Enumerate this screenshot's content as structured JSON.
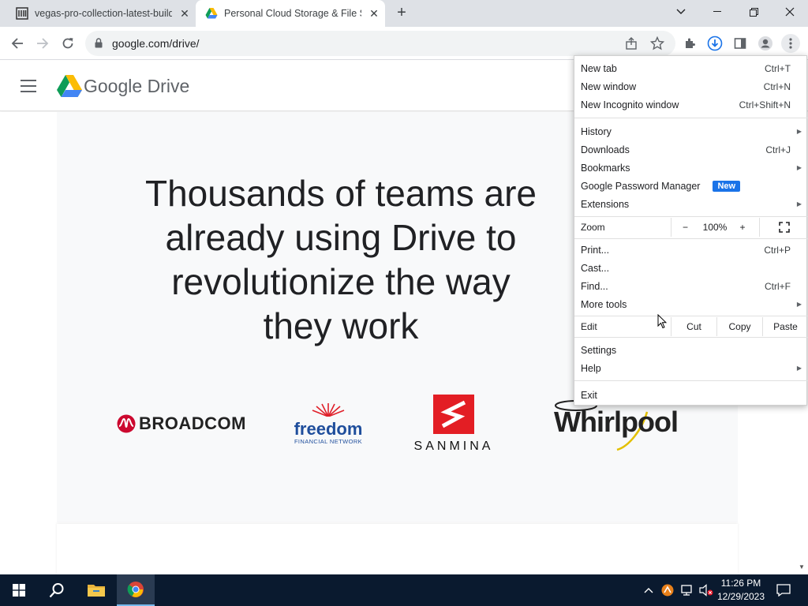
{
  "browser": {
    "tabs": [
      {
        "title": "vegas-pro-collection-latest-build",
        "active": false
      },
      {
        "title": "Personal Cloud Storage & File Sh",
        "active": true
      }
    ],
    "url": "google.com/drive/"
  },
  "page": {
    "brand": {
      "google": "Google",
      "drive": "Drive"
    },
    "hero": "Thousands of teams are already using Drive to revolutionize the way they work",
    "logos": {
      "broadcom": "BROADCOM",
      "freedom": "freedom",
      "freedom_sub": "FINANCIAL NETWORK",
      "sanmina": "SANMINA",
      "whirlpool": "Whirlpool"
    }
  },
  "menu": {
    "group1": [
      {
        "label": "New tab",
        "shortcut": "Ctrl+T"
      },
      {
        "label": "New window",
        "shortcut": "Ctrl+N"
      },
      {
        "label": "New Incognito window",
        "shortcut": "Ctrl+Shift+N"
      }
    ],
    "group2": [
      {
        "label": "History",
        "submenu": true
      },
      {
        "label": "Downloads",
        "shortcut": "Ctrl+J"
      },
      {
        "label": "Bookmarks",
        "submenu": true
      },
      {
        "label": "Google Password Manager",
        "badge": "New"
      },
      {
        "label": "Extensions",
        "submenu": true
      }
    ],
    "zoom": {
      "label": "Zoom",
      "minus": "−",
      "value": "100%",
      "plus": "+"
    },
    "group3": [
      {
        "label": "Print...",
        "shortcut": "Ctrl+P"
      },
      {
        "label": "Cast..."
      },
      {
        "label": "Find...",
        "shortcut": "Ctrl+F"
      },
      {
        "label": "More tools",
        "submenu": true
      }
    ],
    "edit": {
      "label": "Edit",
      "cut": "Cut",
      "copy": "Copy",
      "paste": "Paste"
    },
    "group4": [
      {
        "label": "Settings"
      },
      {
        "label": "Help",
        "submenu": true
      }
    ],
    "exit": "Exit"
  },
  "taskbar": {
    "time": "11:26 PM",
    "date": "12/29/2023"
  }
}
